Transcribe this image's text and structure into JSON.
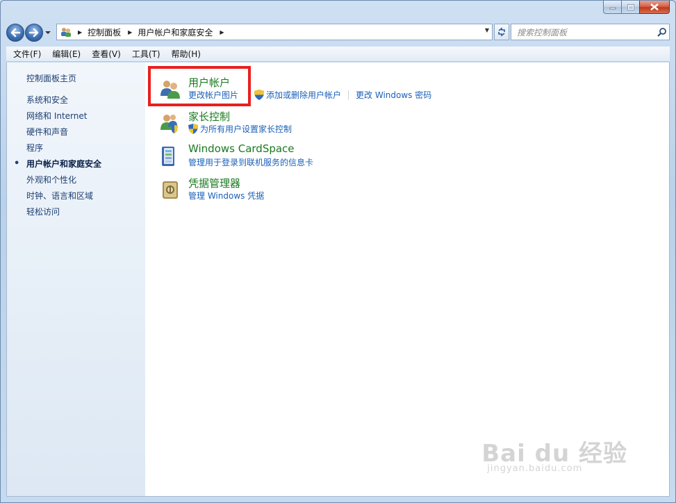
{
  "breadcrumb": [
    "控制面板",
    "用户帐户和家庭安全"
  ],
  "search": {
    "placeholder": "搜索控制面板"
  },
  "menu": [
    "文件(F)",
    "编辑(E)",
    "查看(V)",
    "工具(T)",
    "帮助(H)"
  ],
  "sidebar": {
    "home": "控制面板主页",
    "items": [
      {
        "label": "系统和安全",
        "active": false
      },
      {
        "label": "网络和 Internet",
        "active": false
      },
      {
        "label": "硬件和声音",
        "active": false
      },
      {
        "label": "程序",
        "active": false
      },
      {
        "label": "用户帐户和家庭安全",
        "active": true
      },
      {
        "label": "外观和个性化",
        "active": false
      },
      {
        "label": "时钟、语言和区域",
        "active": false
      },
      {
        "label": "轻松访问",
        "active": false
      }
    ]
  },
  "categories": [
    {
      "title": "用户帐户",
      "icon": "users-icon",
      "links": [
        "更改帐户图片",
        "添加或删除用户帐户",
        "更改 Windows 密码"
      ]
    },
    {
      "title": "家长控制",
      "icon": "parental-control-icon",
      "links": [
        "为所有用户设置家长控制"
      ]
    },
    {
      "title": "Windows CardSpace",
      "icon": "cardspace-icon",
      "links": [
        "管理用于登录到联机服务的信息卡"
      ]
    },
    {
      "title": "凭据管理器",
      "icon": "credential-manager-icon",
      "links": [
        "管理 Windows 凭据"
      ]
    }
  ],
  "watermark": {
    "logo": "Bai du 经验",
    "url": "jingyan.baidu.com"
  },
  "colors": {
    "link": "#1a60b8",
    "category_title": "#18791e",
    "highlight": "#e8201e"
  }
}
